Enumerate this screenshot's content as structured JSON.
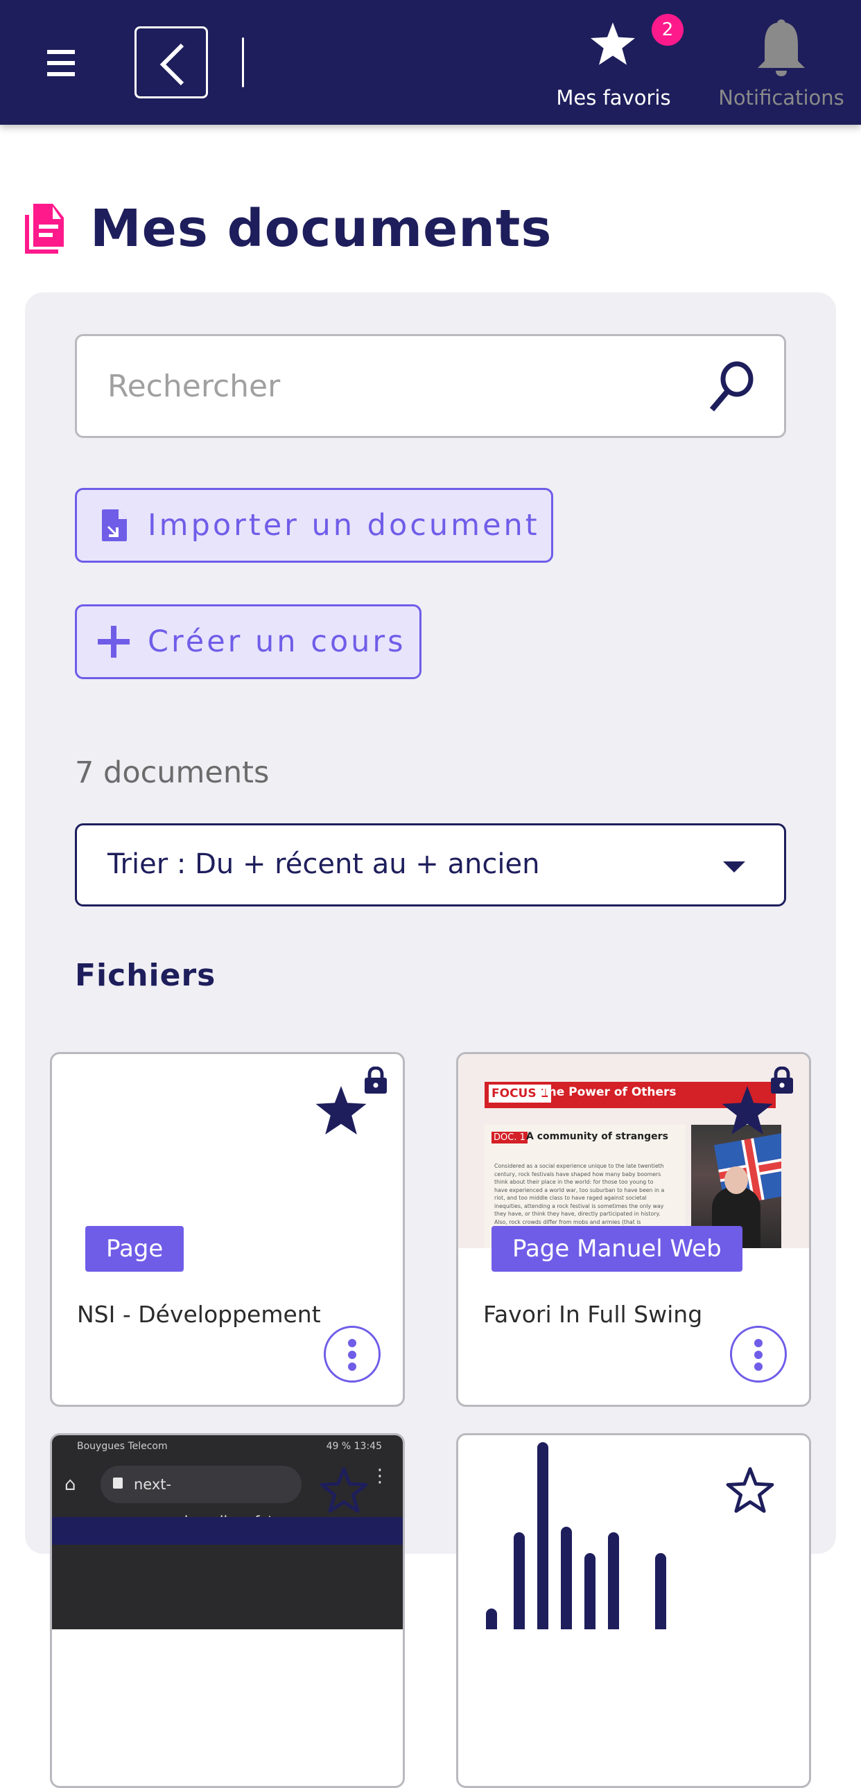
{
  "topbar": {
    "menu_icon": "hamburger-menu-icon",
    "back_icon": "chevron-left-icon",
    "favorites": {
      "label": "Mes favoris",
      "icon": "star-icon",
      "badge_count": "2"
    },
    "notifications": {
      "label": "Notifications",
      "icon": "bell-icon"
    }
  },
  "page": {
    "title": "Mes documents",
    "title_icon": "documents-icon"
  },
  "search": {
    "placeholder": "Rechercher",
    "value": "",
    "icon": "search-icon"
  },
  "actions": {
    "import_label": "Importer un document",
    "create_label": "Créer un cours"
  },
  "doc_count": "7 documents",
  "sort": {
    "selected": "Trier : Du + récent au + ancien"
  },
  "section_title": "Fichiers",
  "colors": {
    "primary": "#1e1e5c",
    "accent": "#6f5de8",
    "badge": "#ff1a8c",
    "title_icon": "#ff1a8c"
  },
  "cards": [
    {
      "title": "NSI - Développement",
      "type": "Page",
      "favorited": true,
      "locked": true
    },
    {
      "title": "Favori In Full Swing",
      "type": "Page Manuel Web",
      "favorited": true,
      "locked": true,
      "thumbnail": {
        "focus_label": "FOCUS 1",
        "banner_title": "The Power of Others",
        "doc_label": "DOC. 1",
        "doc_title": "A community of strangers",
        "body": "Considered as a social experience unique to the late twentieth century, rock festivals have shaped how many baby boomers think about their place in the world: for those too young to have experienced a world war, too suburban to have been in a riot, and too middle class to have raged against societal inequities, attending a rock festival is sometimes the only way they have, or think they have, directly participated in history. Also, rock crowds differ from mobs and armies (that is"
      }
    },
    {
      "title": "",
      "type": "",
      "favorited": false,
      "locked": false,
      "thumbnail": {
        "carrier": "Bouygues Telecom",
        "status_right": "49 % 13:45",
        "url": "next-rece.educadhoc.fr/"
      }
    },
    {
      "title": "",
      "type": "",
      "favorited": false,
      "locked": false
    }
  ]
}
